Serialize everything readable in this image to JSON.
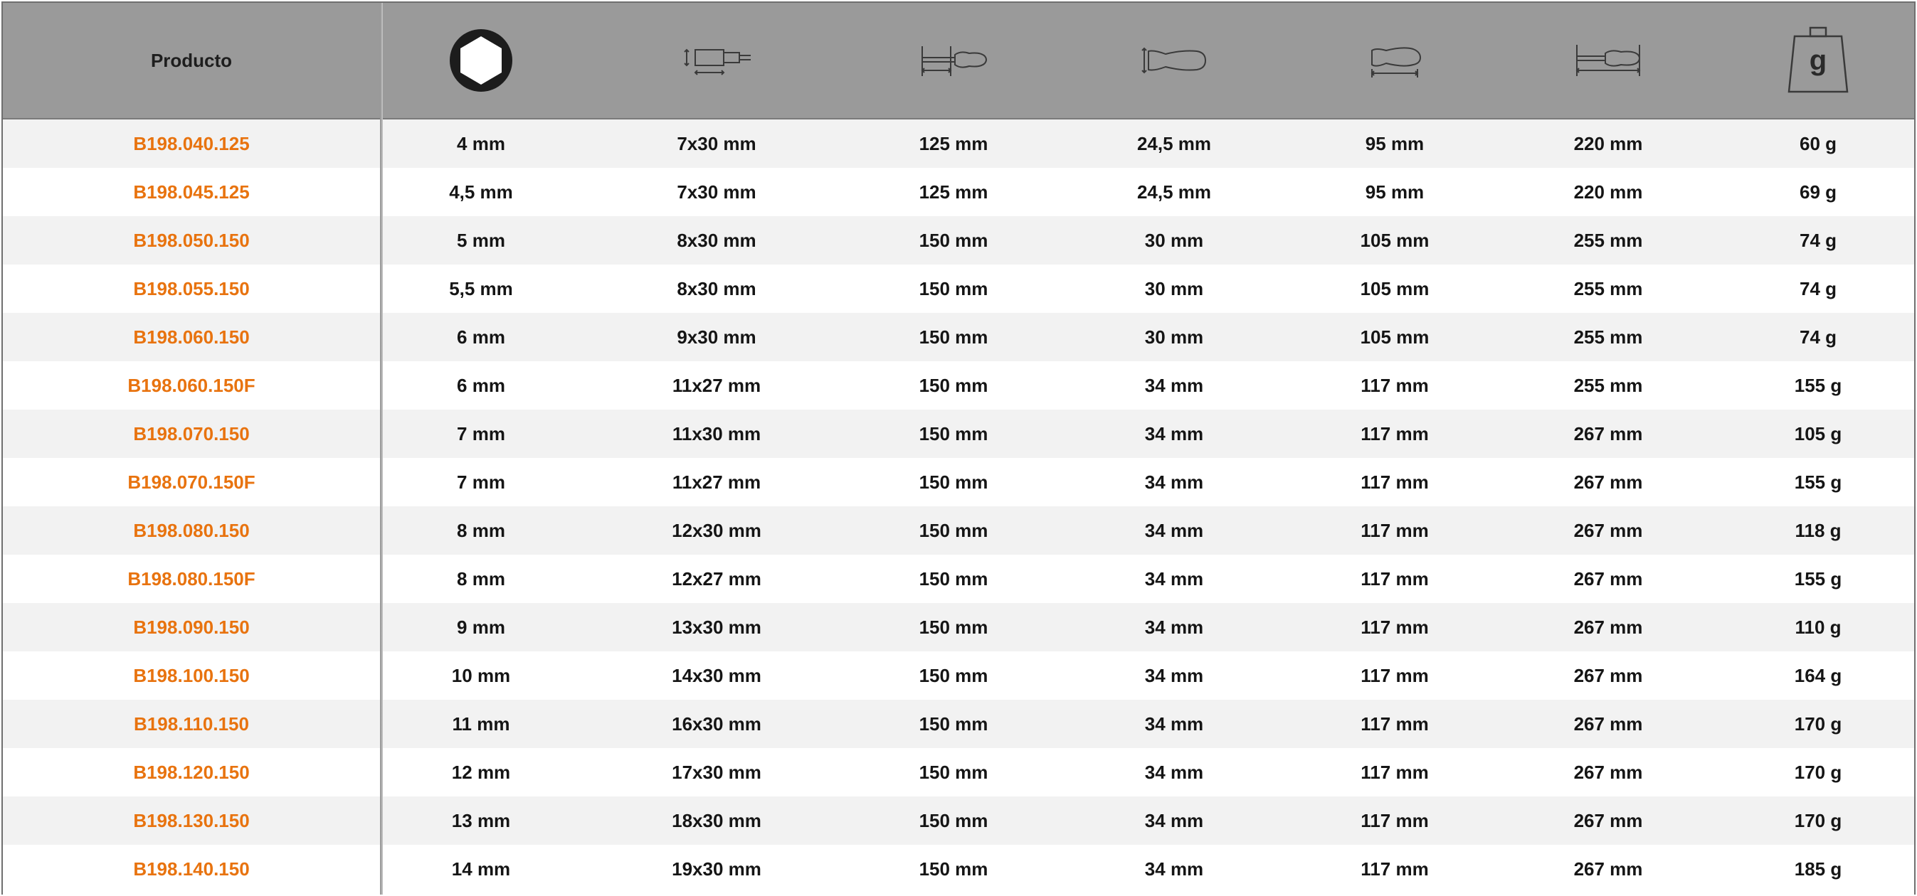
{
  "header": {
    "product_label": "Producto",
    "icons": [
      "hex-socket-icon",
      "socket-dimensions-icon",
      "blade-length-icon",
      "handle-diameter-icon",
      "handle-length-icon",
      "total-length-icon",
      "weight-icon"
    ],
    "weight_glyph": "g"
  },
  "colors": {
    "header_bg": "#9a9a9a",
    "row_alt": "#f2f2f2",
    "product_code": "#e8730f",
    "text": "#151515"
  },
  "rows": [
    {
      "product": "B198.040.125",
      "hex": "4 mm",
      "socket": "7x30 mm",
      "blade": "125 mm",
      "handle_dia": "24,5 mm",
      "handle_len": "95 mm",
      "total": "220 mm",
      "weight": "60 g"
    },
    {
      "product": "B198.045.125",
      "hex": "4,5 mm",
      "socket": "7x30 mm",
      "blade": "125 mm",
      "handle_dia": "24,5 mm",
      "handle_len": "95 mm",
      "total": "220 mm",
      "weight": "69 g"
    },
    {
      "product": "B198.050.150",
      "hex": "5 mm",
      "socket": "8x30 mm",
      "blade": "150 mm",
      "handle_dia": "30 mm",
      "handle_len": "105 mm",
      "total": "255 mm",
      "weight": "74 g"
    },
    {
      "product": "B198.055.150",
      "hex": "5,5 mm",
      "socket": "8x30 mm",
      "blade": "150 mm",
      "handle_dia": "30 mm",
      "handle_len": "105 mm",
      "total": "255 mm",
      "weight": "74 g"
    },
    {
      "product": "B198.060.150",
      "hex": "6 mm",
      "socket": "9x30 mm",
      "blade": "150 mm",
      "handle_dia": "30 mm",
      "handle_len": "105 mm",
      "total": "255 mm",
      "weight": "74 g"
    },
    {
      "product": "B198.060.150F",
      "hex": "6 mm",
      "socket": "11x27 mm",
      "blade": "150 mm",
      "handle_dia": "34 mm",
      "handle_len": "117 mm",
      "total": "255 mm",
      "weight": "155 g"
    },
    {
      "product": "B198.070.150",
      "hex": "7 mm",
      "socket": "11x30 mm",
      "blade": "150 mm",
      "handle_dia": "34 mm",
      "handle_len": "117 mm",
      "total": "267 mm",
      "weight": "105 g"
    },
    {
      "product": "B198.070.150F",
      "hex": "7 mm",
      "socket": "11x27 mm",
      "blade": "150 mm",
      "handle_dia": "34 mm",
      "handle_len": "117 mm",
      "total": "267 mm",
      "weight": "155 g"
    },
    {
      "product": "B198.080.150",
      "hex": "8 mm",
      "socket": "12x30 mm",
      "blade": "150 mm",
      "handle_dia": "34 mm",
      "handle_len": "117 mm",
      "total": "267 mm",
      "weight": "118 g"
    },
    {
      "product": "B198.080.150F",
      "hex": "8 mm",
      "socket": "12x27 mm",
      "blade": "150 mm",
      "handle_dia": "34 mm",
      "handle_len": "117 mm",
      "total": "267 mm",
      "weight": "155 g"
    },
    {
      "product": "B198.090.150",
      "hex": "9 mm",
      "socket": "13x30 mm",
      "blade": "150 mm",
      "handle_dia": "34 mm",
      "handle_len": "117 mm",
      "total": "267 mm",
      "weight": "110 g"
    },
    {
      "product": "B198.100.150",
      "hex": "10 mm",
      "socket": "14x30 mm",
      "blade": "150 mm",
      "handle_dia": "34 mm",
      "handle_len": "117 mm",
      "total": "267 mm",
      "weight": "164 g"
    },
    {
      "product": "B198.110.150",
      "hex": "11 mm",
      "socket": "16x30 mm",
      "blade": "150 mm",
      "handle_dia": "34 mm",
      "handle_len": "117 mm",
      "total": "267 mm",
      "weight": "170 g"
    },
    {
      "product": "B198.120.150",
      "hex": "12 mm",
      "socket": "17x30 mm",
      "blade": "150 mm",
      "handle_dia": "34 mm",
      "handle_len": "117 mm",
      "total": "267 mm",
      "weight": "170 g"
    },
    {
      "product": "B198.130.150",
      "hex": "13 mm",
      "socket": "18x30 mm",
      "blade": "150 mm",
      "handle_dia": "34 mm",
      "handle_len": "117 mm",
      "total": "267 mm",
      "weight": "170 g"
    },
    {
      "product": "B198.140.150",
      "hex": "14 mm",
      "socket": "19x30 mm",
      "blade": "150 mm",
      "handle_dia": "34 mm",
      "handle_len": "117 mm",
      "total": "267 mm",
      "weight": "185 g"
    }
  ]
}
